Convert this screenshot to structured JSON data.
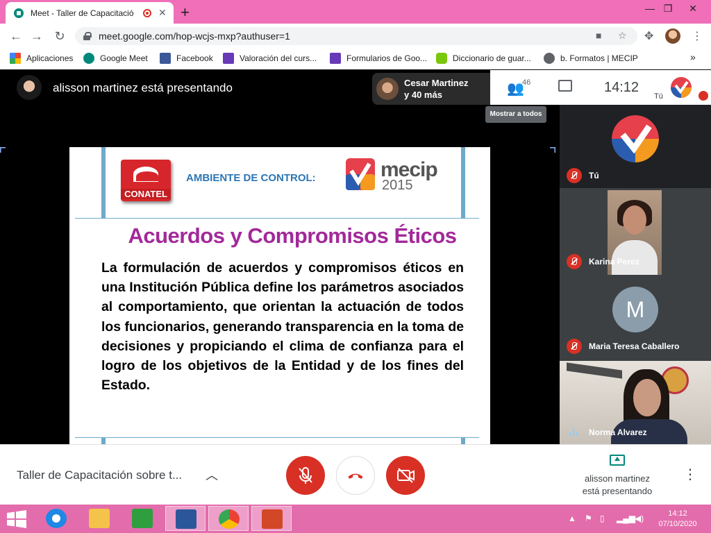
{
  "browser": {
    "tab_title": "Meet - Taller de Capacitació",
    "tab_close": "✕",
    "new_tab": "+",
    "url": "meet.google.com/hop-wcjs-mxp?authuser=1",
    "window_controls": [
      "—",
      "❐",
      "✕"
    ],
    "bookmarks": [
      {
        "label": "Aplicaciones",
        "icon": "apps-grid-icon",
        "color": "#4285f4"
      },
      {
        "label": "Google Meet",
        "icon": "meet-icon",
        "color": "#00897b"
      },
      {
        "label": "Facebook",
        "icon": "facebook-icon",
        "color": "#3b5998"
      },
      {
        "label": "Valoración del curs...",
        "icon": "forms-icon",
        "color": "#673ab7"
      },
      {
        "label": "Formularios de Goo...",
        "icon": "forms-icon",
        "color": "#673ab7"
      },
      {
        "label": "Diccionario de guar...",
        "icon": "duolingo-icon",
        "color": "#7ac70c"
      },
      {
        "label": "b. Formatos | MECIP",
        "icon": "globe-icon",
        "color": "#5f6368"
      }
    ],
    "bookmarks_more": "»"
  },
  "meet": {
    "presenter_banner": "alisson martinez está presentando",
    "participants_summary": [
      "Cesar Martinez",
      "y 40 más"
    ],
    "people_count": "46",
    "clock": "14:12",
    "self_label": "Tú",
    "tooltip": "Mostrar a todos",
    "tiles": [
      {
        "name": "Tú",
        "muted": true
      },
      {
        "name": "Karina Perez",
        "muted": true
      },
      {
        "name": "Maria Teresa Caballero",
        "muted": true,
        "initial": "M"
      },
      {
        "name": "Norma Alvarez",
        "muted": false
      }
    ],
    "meeting_title": "Taller de Capacitación sobre t...",
    "presenting_label": [
      "alisson martinez",
      "está presentando"
    ]
  },
  "slide": {
    "org": "CONATEL",
    "section": "AMBIENTE DE CONTROL:",
    "brand_word": "mecip",
    "brand_year": "2015",
    "title": "Acuerdos y Compromisos Éticos",
    "body": "La formulación de acuerdos y compromisos éticos en una Institución Pública  define los parámetros asociados al comportamiento, que orientan la actuación de todos los funcionarios, generando transparencia en la toma de decisiones y propiciando el clima de confianza para el logro de los objetivos de la Entidad y de los fines del Estado."
  },
  "taskbar": {
    "apps": [
      "internet-explorer",
      "file-explorer",
      "store",
      "word",
      "chrome",
      "powerpoint"
    ],
    "time": "14:12",
    "date": "07/10/2020"
  },
  "colors": {
    "accent_pink": "#f06fb8",
    "meet_red": "#d93025",
    "slide_title": "#a2299a",
    "slide_heading": "#2c76b4"
  }
}
